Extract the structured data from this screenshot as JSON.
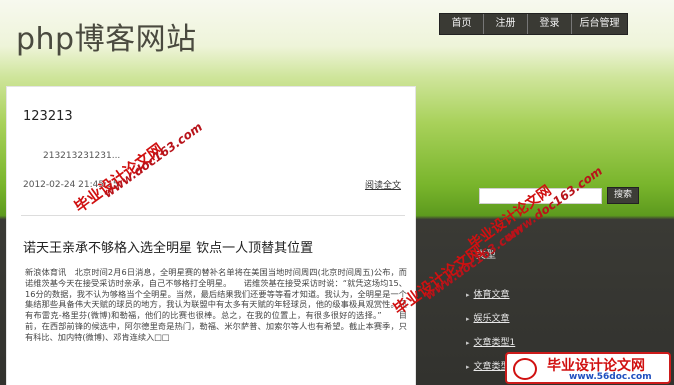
{
  "site": {
    "title": "php博客网站"
  },
  "nav": {
    "items": [
      "首页",
      "注册",
      "登录",
      "后台管理"
    ]
  },
  "post": {
    "title": "123213",
    "excerpt": "213213231231...",
    "date": "2012-02-24 21:45:15",
    "read_more": "阅读全文"
  },
  "article": {
    "title": "诺天王亲承不够格入选全明星 钦点一人顶替其位置",
    "body": "新浪体育讯　北京时间2月6日消息，全明星赛的替补名单将在美国当地时间周四(北京时间周五)公布，而诺维茨基今天在接受采访时亲承，自己不够格打全明星。　　诺维茨基在接受采访时说：“就凭这场均15、16分的数据，我不认为够格当个全明星。当然，最后结果我们还要等等看才知道。我认为，全明星是一个集结那些具备伟大天赋的球员的地方，我认为联盟中有太多有天赋的年轻球员，他的级事极具观赏性。还有布雷克-格里芬(微博)和勒福，他们的比赛也很棒。总之，在我的位置上，有很多很好的选择。”　　目前，在西部前锋的候选中，阿尔德里奇是热门，勒福、米尔萨普、加索尔等人也有希望。截止本赛季，只有科比、加内特(微博)、邓肯连续入□□"
  },
  "search": {
    "placeholder": "",
    "button": "搜索"
  },
  "sidebar": {
    "heading": "类型",
    "links": [
      "体育文章",
      "娱乐文章",
      "文章类型1",
      "文章类型2"
    ]
  },
  "watermarks": {
    "url": "www.doc163.com",
    "slogan": "毕业设计论文网",
    "logo_text": "毕业设计论文网",
    "logo_url": "www.56doc.com"
  },
  "colors": {
    "nav_bg": "#3a3a34",
    "header_green": "#79b52c",
    "sidebar_bg": "#32322e",
    "watermark_red": "#d01010"
  }
}
